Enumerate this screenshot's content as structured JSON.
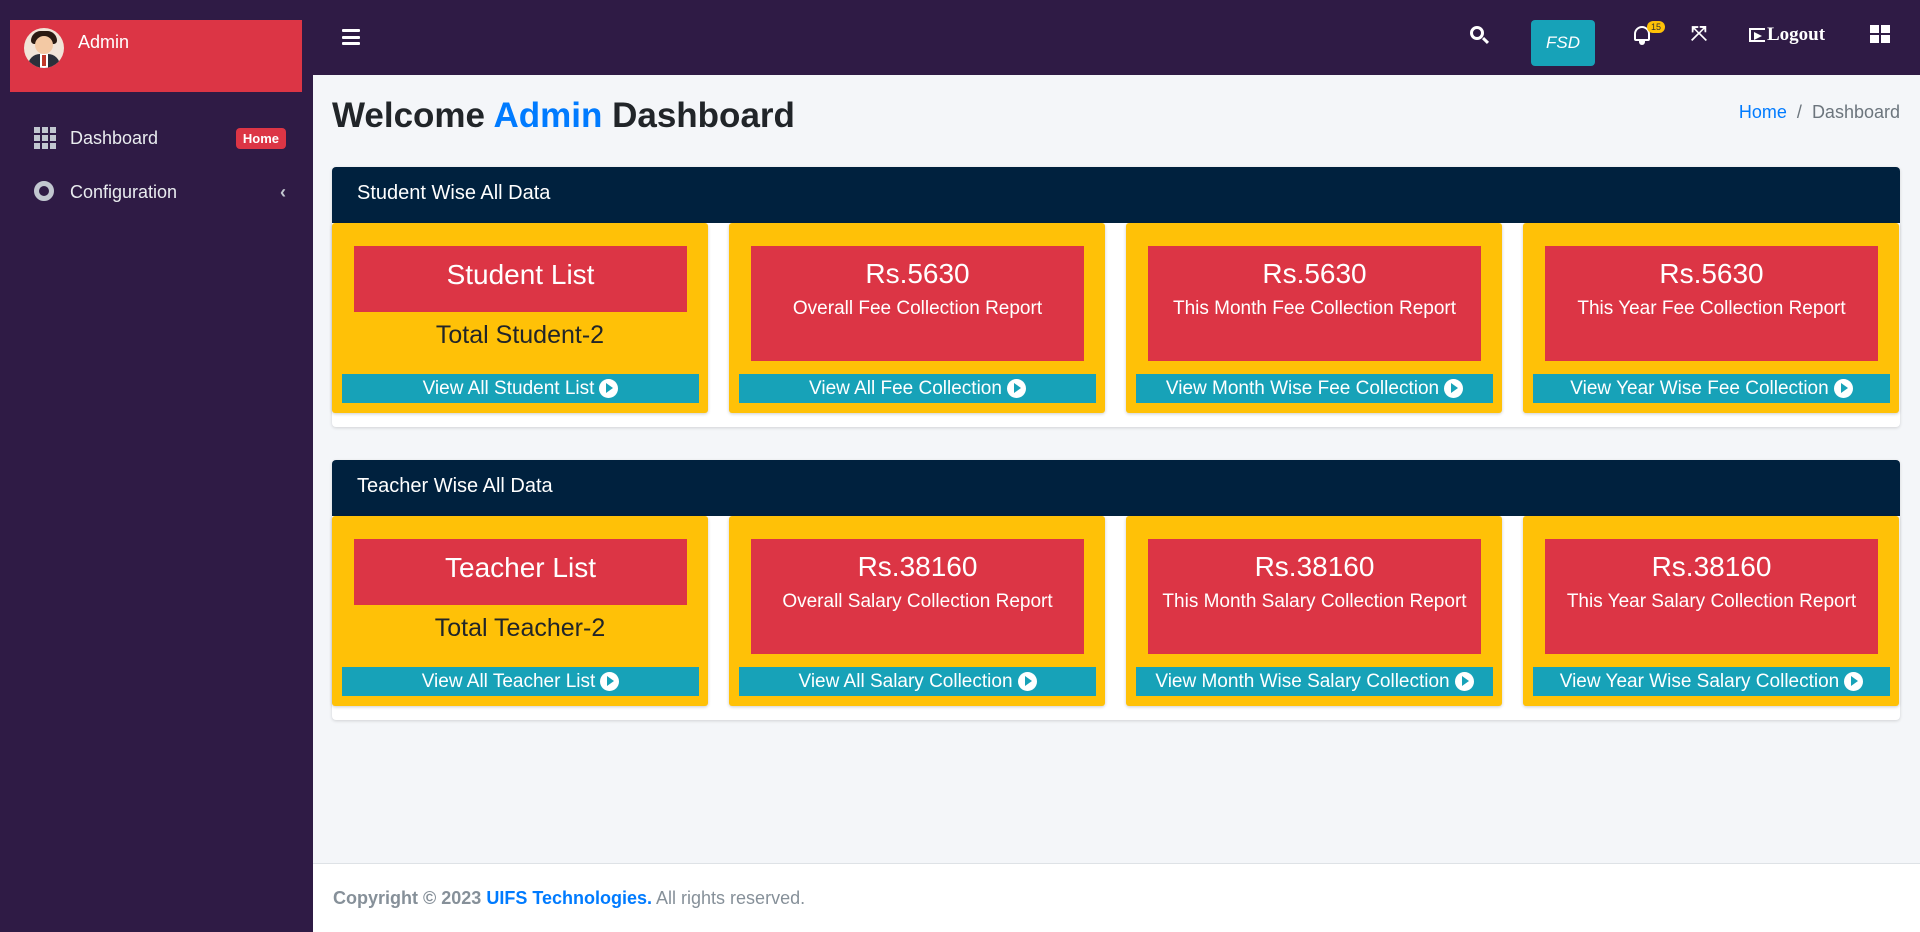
{
  "sidebar": {
    "user_name": "Admin",
    "items": [
      {
        "label": "Dashboard",
        "badge": "Home",
        "icon": "grid-icon"
      },
      {
        "label": "Configuration",
        "icon": "gear-icon"
      }
    ]
  },
  "topbar": {
    "fsd_label": "FSD",
    "notification_count": "15",
    "logout_label": "Logout"
  },
  "header": {
    "title_prefix": "Welcome",
    "title_highlight": "Admin",
    "title_suffix": "Dashboard",
    "breadcrumb": [
      "Home",
      "Dashboard"
    ]
  },
  "sections": [
    {
      "title": "Student Wise All Data",
      "list_card": {
        "title": "Student List",
        "total": "Total Student-2",
        "button": "View All Student List"
      },
      "report_cards": [
        {
          "amount": "Rs.5630",
          "label": "Overall Fee Collection Report",
          "button": "View All Fee Collection"
        },
        {
          "amount": "Rs.5630",
          "label": "This Month Fee Collection Report",
          "button": "View Month Wise Fee Collection"
        },
        {
          "amount": "Rs.5630",
          "label": "This Year Fee Collection Report",
          "button": "View Year Wise Fee Collection"
        }
      ]
    },
    {
      "title": "Teacher Wise All Data",
      "list_card": {
        "title": "Teacher List",
        "total": "Total Teacher-2",
        "button": "View All Teacher List"
      },
      "report_cards": [
        {
          "amount": "Rs.38160",
          "label": "Overall Salary Collection Report",
          "button": "View All Salary Collection"
        },
        {
          "amount": "Rs.38160",
          "label": "This Month Salary Collection Report",
          "button": "View Month Wise Salary Collection"
        },
        {
          "amount": "Rs.38160",
          "label": "This Year Salary Collection Report",
          "button": "View Year Wise Salary Collection"
        }
      ]
    }
  ],
  "footer": {
    "copyright": "Copyright © 2023",
    "company": "UIFS Technologies.",
    "rights": "All rights reserved."
  },
  "colors": {
    "sidebar_bg": "#2f1b45",
    "accent_red": "#dc3545",
    "card_yellow": "#ffc107",
    "button_teal": "#17a2b8",
    "section_header": "#00213e",
    "link_blue": "#007bff"
  }
}
